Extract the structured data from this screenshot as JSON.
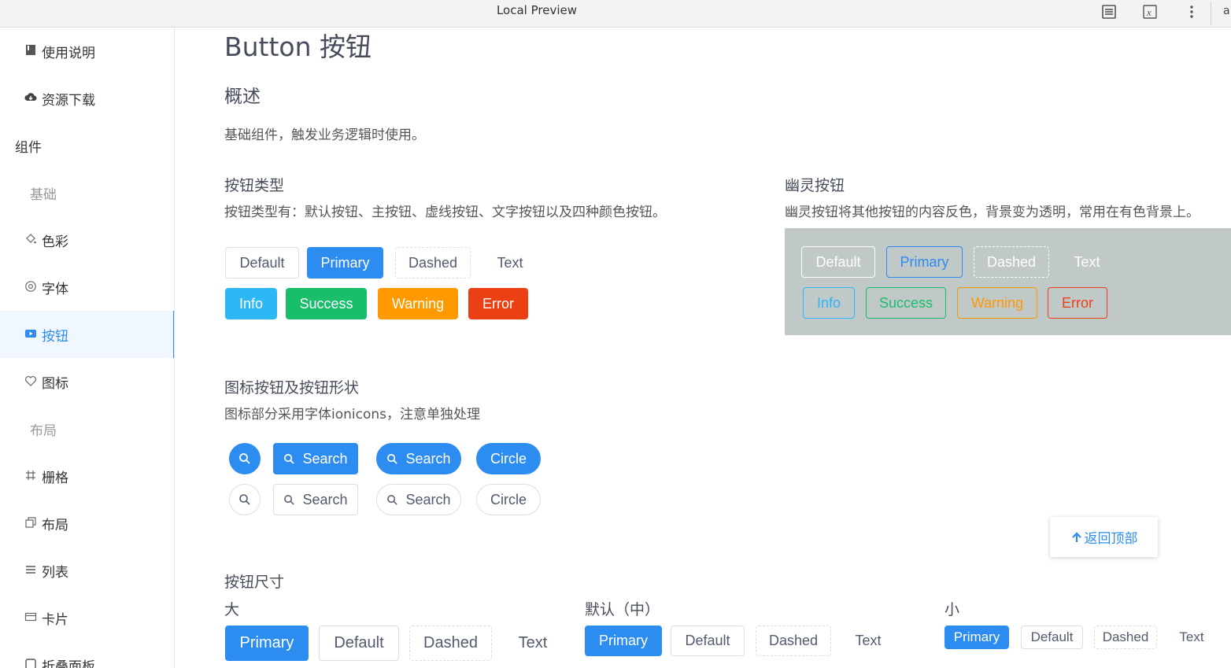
{
  "window": {
    "title": "Local Preview",
    "partial_icon_glyph": "a"
  },
  "sidebar": {
    "items": [
      {
        "label": "使用说明",
        "icon": "book-icon",
        "kind": "link"
      },
      {
        "label": "资源下载",
        "icon": "cloud-download-icon",
        "kind": "link"
      },
      {
        "label": "组件",
        "kind": "group"
      },
      {
        "label": "基础",
        "kind": "subgroup"
      },
      {
        "label": "色彩",
        "icon": "paint-bucket-icon",
        "kind": "link"
      },
      {
        "label": "字体",
        "icon": "at-icon",
        "kind": "link"
      },
      {
        "label": "按钮",
        "icon": "play-button-icon",
        "kind": "link",
        "active": true
      },
      {
        "label": "图标",
        "icon": "heart-icon",
        "kind": "link"
      },
      {
        "label": "布局",
        "kind": "subgroup"
      },
      {
        "label": "栅格",
        "icon": "grid-icon",
        "kind": "link"
      },
      {
        "label": "布局",
        "icon": "layout-icon",
        "kind": "link"
      },
      {
        "label": "列表",
        "icon": "list-icon",
        "kind": "link"
      },
      {
        "label": "卡片",
        "icon": "card-icon",
        "kind": "link"
      },
      {
        "label": "折叠面板",
        "icon": "collapse-icon",
        "kind": "link"
      }
    ]
  },
  "main": {
    "page_title": "Button 按钮",
    "overview": {
      "heading": "概述",
      "text": "基础组件，触发业务逻辑时使用。"
    },
    "types": {
      "heading": "按钮类型",
      "desc": "按钮类型有：默认按钮、主按钮、虚线按钮、文字按钮以及四种颜色按钮。",
      "row1": [
        "Default",
        "Primary",
        "Dashed",
        "Text"
      ],
      "row2": [
        "Info",
        "Success",
        "Warning",
        "Error"
      ]
    },
    "ghost": {
      "heading": "幽灵按钮",
      "desc": "幽灵按钮将其他按钮的内容反色，背景变为透明，常用在有色背景上。",
      "row1": [
        "Default",
        "Primary",
        "Dashed",
        "Text"
      ],
      "row2": [
        "Info",
        "Success",
        "Warning",
        "Error"
      ]
    },
    "icon_buttons": {
      "heading": "图标按钮及按钮形状",
      "desc": "图标部分采用字体ionicons，注意单独处理",
      "search_label": "Search",
      "circle_label": "Circle"
    },
    "sizes": {
      "heading": "按钮尺寸",
      "large": {
        "label": "大",
        "buttons": [
          "Primary",
          "Default",
          "Dashed",
          "Text"
        ]
      },
      "default": {
        "label": "默认（中）",
        "buttons": [
          "Primary",
          "Default",
          "Dashed",
          "Text"
        ]
      },
      "small": {
        "label": "小",
        "buttons": [
          "Primary",
          "Default",
          "Dashed",
          "Text"
        ]
      }
    },
    "back_to_top": "返回顶部"
  },
  "colors": {
    "primary": "#2d8cf0",
    "info": "#2db7f5",
    "success": "#19be6b",
    "warning": "#ff9900",
    "error": "#ed3f14",
    "ghost_bg": "#c0c8c8"
  }
}
